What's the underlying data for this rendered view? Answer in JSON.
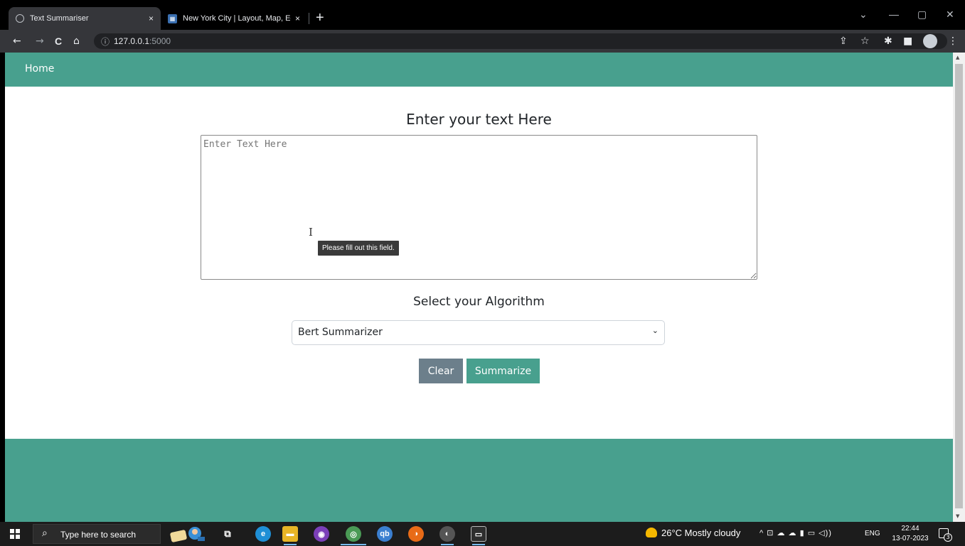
{
  "browser": {
    "tabs": [
      {
        "title": "Text Summariser",
        "favicon": "globe-icon",
        "active": true
      },
      {
        "title": "New York City | Layout, Map, Eco",
        "favicon": "nyc-favicon-icon",
        "active": false
      }
    ],
    "new_tab_label": "+",
    "url_host": "127.0.0.1",
    "url_port": ":5000",
    "icons": {
      "back": "←",
      "forward": "→",
      "reload": "C",
      "home": "⌂",
      "info": "ⓘ",
      "share": "⇪",
      "star": "☆",
      "extensions": "✱",
      "sidepanel": "■",
      "menu": "⋮",
      "tab_close": "×",
      "chevron": "⌄",
      "minimize": "—",
      "maximize": "▢",
      "close": "✕"
    }
  },
  "page": {
    "nav_home": "Home",
    "heading": "Enter your text Here",
    "textarea_placeholder": "Enter Text Here",
    "validation_tooltip": "Please fill out this field.",
    "text_cursor": "I",
    "algorithm_heading": "Select your Algorithm",
    "algorithm_selected": "Bert Summarizer",
    "select_chevron": "⌄",
    "clear_label": "Clear",
    "summarize_label": "Summarize",
    "colors": {
      "accent": "#48a08e",
      "clear_button": "#6c7f8b",
      "tooltip_bg": "#3a3a3a"
    }
  },
  "taskbar": {
    "search_placeholder": "Type here to search",
    "search_icon": "⌕",
    "task_view_icon": "⧉",
    "apps": [
      {
        "name": "edge-icon",
        "glyph": "e",
        "color": "#1f8fd6"
      },
      {
        "name": "file-explorer-icon",
        "glyph": "▬",
        "color": "#e8b526"
      },
      {
        "name": "tor-browser-icon",
        "glyph": "◉",
        "color": "#7b3fb8"
      },
      {
        "name": "chrome-icon",
        "glyph": "◎",
        "color": "#4a9a55"
      },
      {
        "name": "qbittorrent-icon",
        "glyph": "qb",
        "color": "#3b7fd0"
      },
      {
        "name": "firefox-icon",
        "glyph": "◑",
        "color": "#e86b17"
      },
      {
        "name": "chrome-profile-icon",
        "glyph": "◐",
        "color": "#555555"
      },
      {
        "name": "terminal-icon",
        "glyph": "▭",
        "color": "#2e2e2e"
      }
    ],
    "weather_text": "26°C  Mostly cloudy",
    "tray_language": "ENG",
    "tray_icons": "^  ⊡  ☁  ☁  ▮  ▭  ◁))",
    "time": "22:44",
    "date": "13-07-2023",
    "notification_count": "3"
  }
}
